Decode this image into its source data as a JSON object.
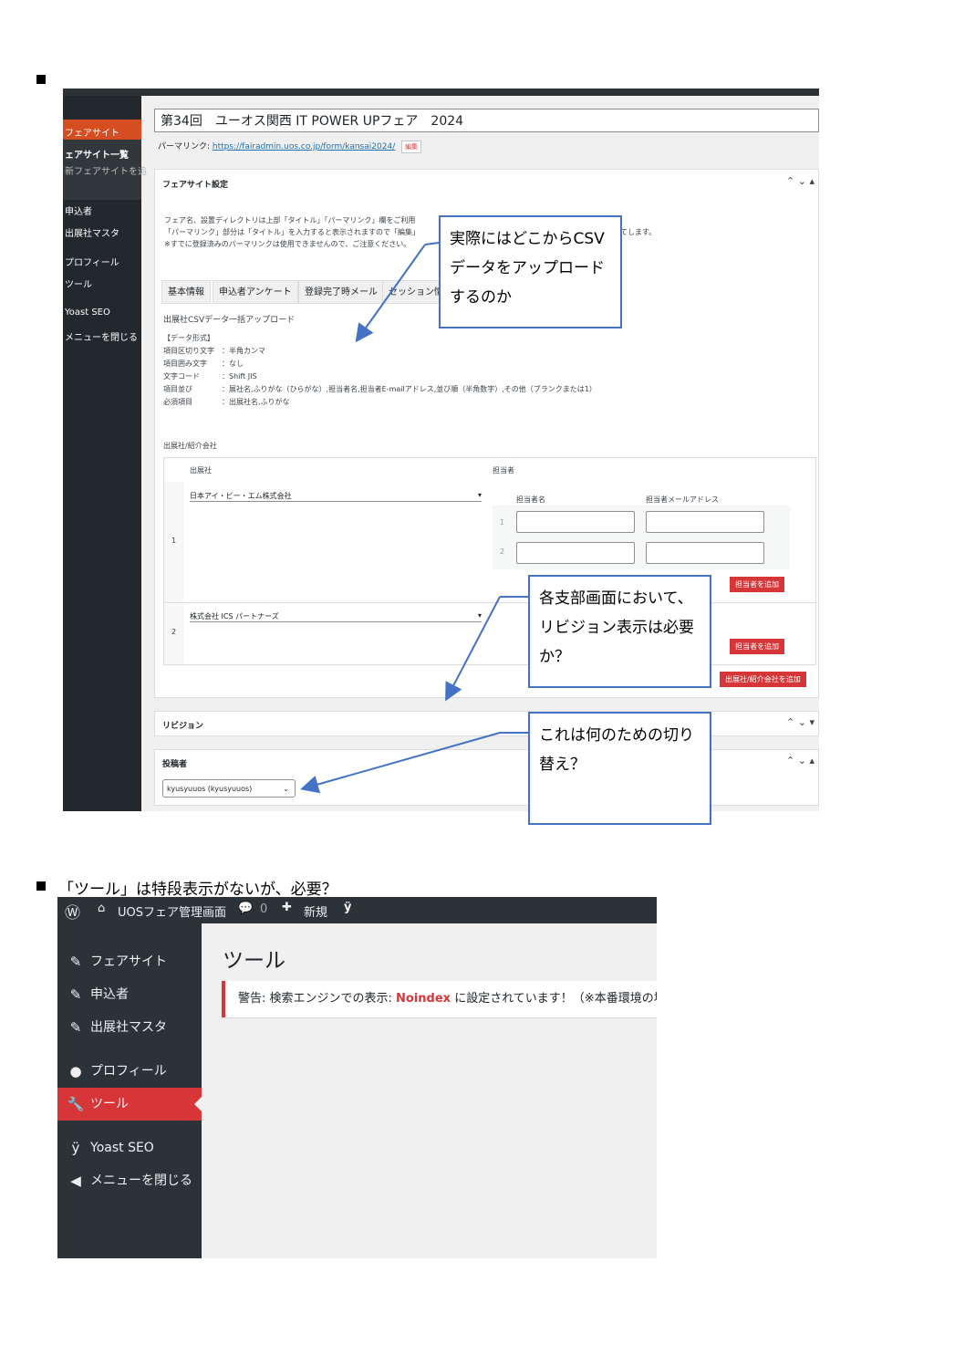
{
  "shot1": {
    "sidebar": {
      "items": [
        "フェアサイト",
        "ェアサイト一覧",
        "新フェアサイトを追",
        "申込者",
        "出展社マスタ",
        "プロフィール",
        "ツール",
        "Yoast SEO",
        "メニューを閉じる"
      ]
    },
    "post_title": "第34回　ユーオス関西 IT POWER UPフェア　2024",
    "permalink": {
      "label": "パーマリンク:",
      "url": "https://fairadmin.uos.co.jp/form/kansai2024/",
      "edit_button": "編集"
    },
    "fair_settings": {
      "heading": "フェアサイト設定",
      "notes": [
        "フェア名、設置ディレクトリは上部「タイトル」「パーマリンク」欄をご利用",
        "「パーマリンク」部分は「タイトル」を入力すると表示されますので「編集」",
        "※すでに登録済みのパーマリンクは使用できませんので、ご注意ください。"
      ],
      "notes_tail": "てします。",
      "tabs": [
        "基本情報",
        "申込者アンケート",
        "登録完了時メール",
        "セッション情"
      ],
      "csv_heading": "出展社CSVデータ一括アップロード",
      "format_lines": [
        "【データ形式】",
        "項目区切り文字　：半角カンマ",
        "項目囲み文字　　：なし",
        "文字コード　　　：Shift JIS",
        "項目並び　　　　：展社名,ふりがな（ひらがな）,担当者名,担当者E-mailアドレス,並び順（半角数字）,その他（ブランクまたは1）",
        "必須項目　　　　：出展社名,ふりがな"
      ],
      "exhibitor_section": "出展社/紹介会社",
      "col_exhibitor": "出展社",
      "col_staff": "担当者",
      "rows": [
        {
          "num": "1",
          "company": "日本アイ・ビー・エム株式会社"
        },
        {
          "num": "2",
          "company": "株式会社 ICS パートナーズ"
        }
      ],
      "staff_cols": [
        "担当者名",
        "担当者メールアドレス"
      ],
      "staff_rows": [
        "1",
        "2"
      ],
      "add_staff": "担当者を追加",
      "add_exhibitor": "出展社/紹介会社を追加"
    },
    "revision_heading": "リビジョン",
    "author": {
      "heading": "投稿者",
      "selected": "kyusyuuos (kyusyuuos)"
    }
  },
  "callouts": [
    "実際にはどこからCSVデータをアップロードするのか",
    "各支部画面において、リビジョン表示は必要か？",
    "これは何のための切り替え？"
  ],
  "caption2": "「ツール」は特段表示がないが、必要？",
  "shot2": {
    "site_name": "UOSフェア管理画面",
    "comments": "0",
    "new_label": "新規",
    "menu": [
      {
        "icon": "pin-icon",
        "label": "フェアサイト"
      },
      {
        "icon": "pin-icon",
        "label": "申込者"
      },
      {
        "icon": "pin-icon",
        "label": "出展社マスタ"
      },
      {
        "icon": "user-icon",
        "label": "プロフィール"
      },
      {
        "icon": "wrench-icon",
        "label": "ツール"
      },
      {
        "icon": "yoast-icon",
        "label": "Yoast SEO"
      },
      {
        "icon": "collapse-icon",
        "label": "メニューを閉じる"
      }
    ],
    "page_title": "ツール",
    "notice_prefix": "警告: 検索エンジンでの表示: ",
    "notice_strong": "Noindex",
    "notice_suffix": " に設定されています！（※本番環境の場合"
  },
  "colors": {
    "callout_border": "#4472c4",
    "admin_dark": "#2c3338",
    "accent_red": "#d63638"
  }
}
